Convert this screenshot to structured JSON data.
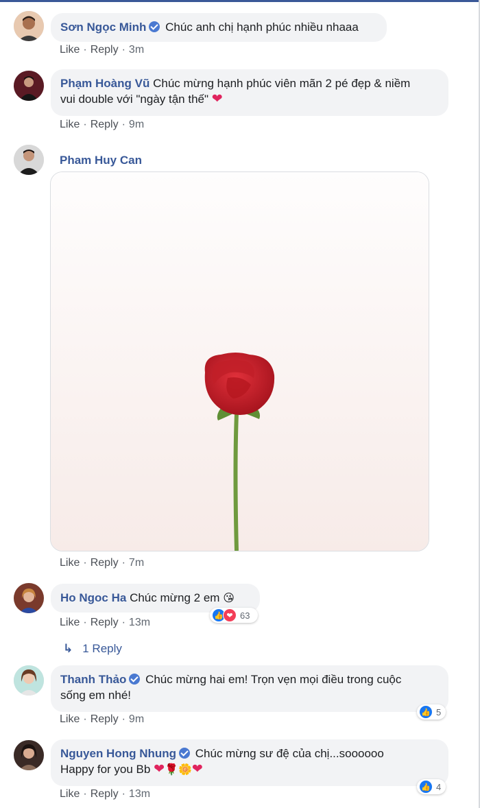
{
  "colors": {
    "link": "#385898",
    "bubble": "#f2f3f5",
    "like_blue": "#1877f2",
    "love_red": "#f33e58",
    "heart": "#e0245e"
  },
  "actions": {
    "like": "Like",
    "reply": "Reply",
    "separator": "·"
  },
  "comments": [
    {
      "author": "Sơn Ngọc Minh",
      "verified": true,
      "text": "Chúc anh chị hạnh phúc nhiều nhaaa",
      "time": "3m"
    },
    {
      "author": "Phạm Hoàng Vũ",
      "verified": false,
      "text_line1": "Chúc mừng hạnh phúc viên mãn 2 pé đẹp & niềm",
      "text_line2": "vui double với \"ngày tận thế\"",
      "emoji": "heart-emoji",
      "time": "9m"
    },
    {
      "author": "Pham Huy Can",
      "verified": false,
      "media": "red rose on white background",
      "time": "7m"
    },
    {
      "author": "Ho Ngoc Ha",
      "verified": false,
      "text": "Chúc mừng 2 em",
      "emoji": "kissing-face-emoji",
      "time": "13m",
      "reactions": {
        "types": [
          "like",
          "love"
        ],
        "count": "63"
      }
    },
    {
      "author": "Thanh Thảo",
      "verified": true,
      "text_line1": "Chúc mừng hai em! Trọn vẹn mọi điều trong cuộc",
      "text_line2": "sống em nhé!",
      "time": "9m",
      "reactions": {
        "types": [
          "like"
        ],
        "count": "5"
      }
    },
    {
      "author": "Nguyen Hong Nhung",
      "verified": true,
      "text_line1": "Chúc mừng sư đệ của chị...soooooo",
      "text_line2": "Happy for you Bb",
      "emojis": [
        "heart-emoji",
        "rose-emoji",
        "flower-emoji",
        "heart-emoji"
      ],
      "time": "13m",
      "reactions": {
        "types": [
          "like"
        ],
        "count": "4"
      }
    }
  ],
  "replies_link": {
    "label": "1 Reply",
    "icon": "reply-arrow-icon"
  }
}
